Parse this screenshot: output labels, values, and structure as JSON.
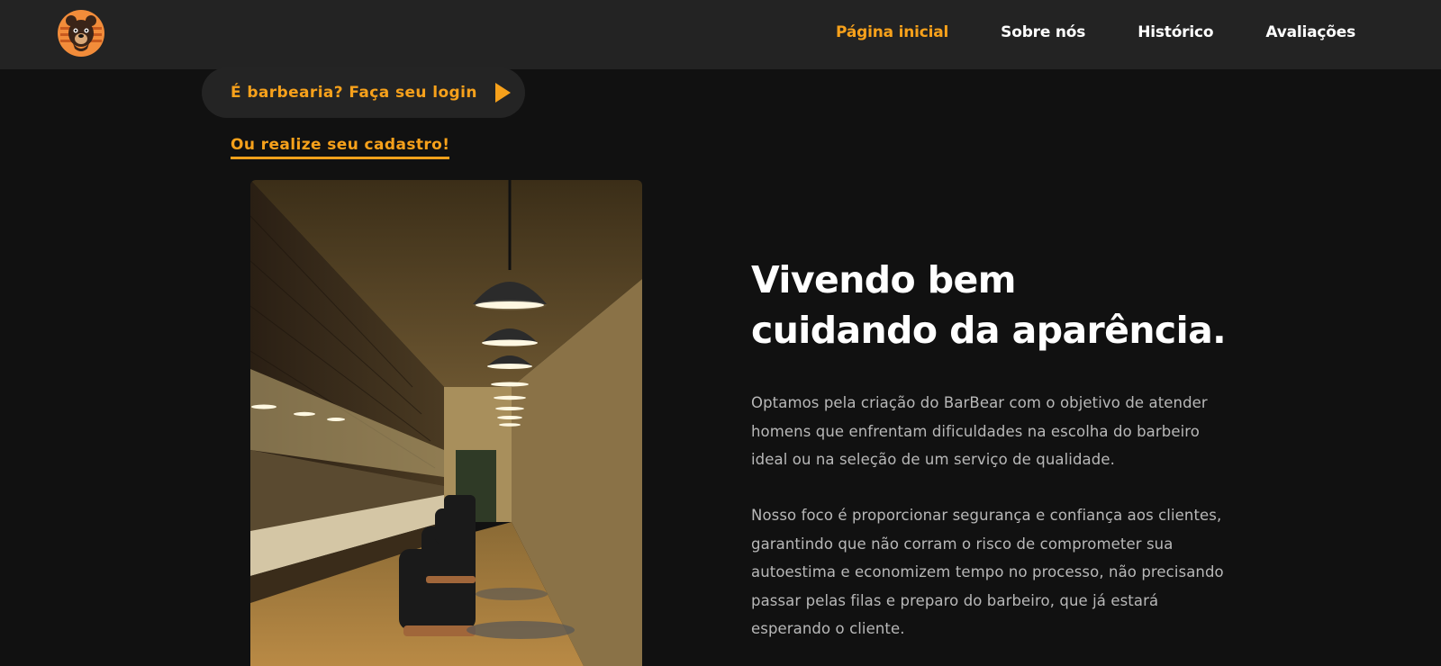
{
  "brand": {
    "logo_icon": "bear-icon",
    "accent_color": "#f7a11b"
  },
  "nav": {
    "items": [
      {
        "label": "Página inicial",
        "active": true
      },
      {
        "label": "Sobre nós",
        "active": false
      },
      {
        "label": "Histórico",
        "active": false
      },
      {
        "label": "Avaliações",
        "active": false
      }
    ]
  },
  "auth": {
    "login_label": "É barbearia? Faça seu login",
    "login_icon": "play-arrow-icon",
    "signup_label": "Ou realize seu cadastro!"
  },
  "hero": {
    "image_subject": "barbershop-interior-photo",
    "title_line1": "Vivendo bem",
    "title_line2": "cuidando da aparência.",
    "paragraph1": "Optamos pela criação do BarBear com o objetivo de atender homens que enfrentam dificuldades na escolha do barbeiro ideal ou na seleção de um serviço de qualidade.",
    "paragraph2": "Nosso foco é proporcionar segurança e confiança aos clientes, garantindo que não corram o risco de comprometer sua autoestima e economizem tempo no processo, não precisando passar pelas filas e preparo do barbeiro, que já estará esperando o cliente."
  }
}
